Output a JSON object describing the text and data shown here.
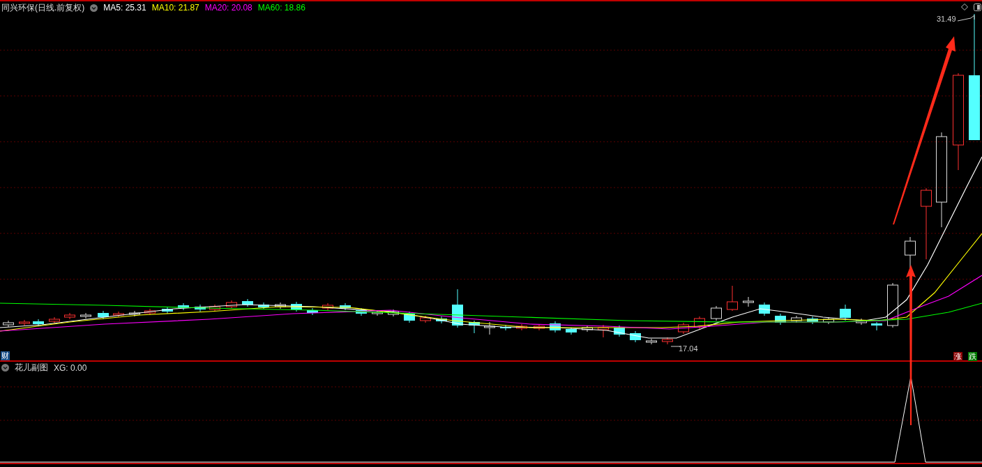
{
  "main_panel": {
    "title": "同兴环保(日线.前复权)",
    "indicators": [
      {
        "label": "MA5: 25.31",
        "color": "#ffffff"
      },
      {
        "label": "MA10: 21.87",
        "color": "#ffff00"
      },
      {
        "label": "MA20: 20.08",
        "color": "#ff00ff"
      },
      {
        "label": "MA60: 18.86",
        "color": "#00ff00"
      }
    ],
    "high_label": "31.49",
    "low_label": "17.04",
    "finance_badge": "财",
    "up_badge": "涨",
    "down_badge": "跌"
  },
  "sub_panel": {
    "title": "花儿副图",
    "indicator": "XG: 0.00"
  }
}
